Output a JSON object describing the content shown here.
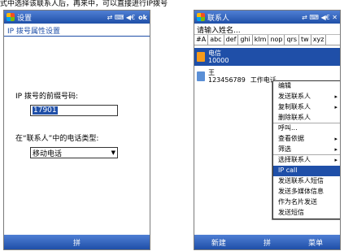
{
  "caption": "式中选择该联系人后，再来中，可以直接进行IP拨号",
  "left": {
    "title": "设置",
    "status": "⇄ ⌨ ◀€",
    "ok": "ok",
    "subheader": "IP 拨号属性设置",
    "prefix_label": "IP 拨号的前缀号码:",
    "prefix_value": "17901",
    "phone_type_label": "在“联系人”中的电话类型:",
    "phone_type_value": "移动电话",
    "bottom_center": "拼"
  },
  "right": {
    "title": "联系人",
    "status": "⇄ ⌨ ◀€ ✕",
    "search_placeholder": "请输入姓名...",
    "alpha_tabs": [
      "#A",
      "abc",
      "def",
      "ghi",
      "klm",
      "nop",
      "qrs",
      "tw",
      "xyz"
    ],
    "contacts": [
      {
        "name": "电信",
        "number": "10000",
        "trail": ""
      },
      {
        "name": "王",
        "number": "123456789",
        "trail": "工作电话"
      }
    ],
    "menu": [
      {
        "label": "编辑",
        "sub": "",
        "sep": false
      },
      {
        "label": "发送联系人",
        "sub": "▸",
        "sep": false
      },
      {
        "label": "复制联系人",
        "sub": "▸",
        "sep": false
      },
      {
        "label": "删除联系人",
        "sub": "",
        "sep": true
      },
      {
        "label": "呼叫...",
        "sub": "",
        "sep": false
      },
      {
        "label": "查看依据",
        "sub": "▸",
        "sep": false
      },
      {
        "label": "筛选",
        "sub": "▸",
        "sep": true
      },
      {
        "label": "选择联系人",
        "sub": "▸",
        "sep": false
      },
      {
        "label": "IP call",
        "sub": "",
        "sep": false,
        "highlight": true
      },
      {
        "label": "发送联系人短信",
        "sub": "",
        "sep": false
      },
      {
        "label": "发送多媒体信息",
        "sub": "",
        "sep": false
      },
      {
        "label": "作为名片发送",
        "sub": "",
        "sep": false
      },
      {
        "label": "发送短信",
        "sub": "",
        "sep": false
      }
    ],
    "softkey_left": "新建",
    "softkey_center": "拼",
    "softkey_right": "菜单"
  },
  "colors": {
    "titlebar": "#1f4fa8",
    "highlight": "#1f4fa8",
    "contact_icon": "#f59a1b"
  }
}
